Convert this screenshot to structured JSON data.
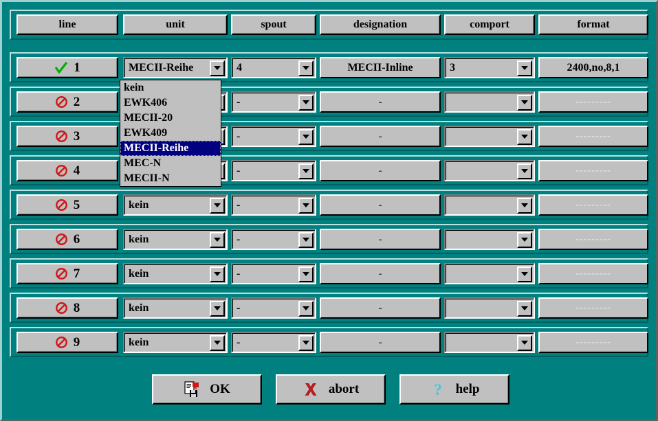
{
  "window": {
    "background_color": "#00807f",
    "control_color": "#c0c0c0"
  },
  "table": {
    "headers": [
      {
        "key": "line",
        "label": "line"
      },
      {
        "key": "unit",
        "label": "unit"
      },
      {
        "key": "spout",
        "label": "spout"
      },
      {
        "key": "designation",
        "label": "designation"
      },
      {
        "key": "comport",
        "label": "comport"
      },
      {
        "key": "format",
        "label": "format"
      }
    ],
    "rows": [
      {
        "line": "1",
        "status_icon": "check-icon",
        "enabled": true,
        "unit": "MECII-Reihe",
        "spout": "4",
        "designation": "MECII-Inline",
        "comport": "3",
        "format": "2400,no,8,1"
      },
      {
        "line": "2",
        "status_icon": "prohibited-icon",
        "enabled": false,
        "unit": "",
        "spout": "-",
        "designation": "-",
        "comport": "",
        "format": "---------"
      },
      {
        "line": "3",
        "status_icon": "prohibited-icon",
        "enabled": false,
        "unit": "",
        "spout": "-",
        "designation": "-",
        "comport": "",
        "format": "---------"
      },
      {
        "line": "4",
        "status_icon": "prohibited-icon",
        "enabled": false,
        "unit": "",
        "spout": "-",
        "designation": "-",
        "comport": "",
        "format": "---------"
      },
      {
        "line": "5",
        "status_icon": "prohibited-icon",
        "enabled": false,
        "unit": "kein",
        "spout": "-",
        "designation": "-",
        "comport": "",
        "format": "---------"
      },
      {
        "line": "6",
        "status_icon": "prohibited-icon",
        "enabled": false,
        "unit": "kein",
        "spout": "-",
        "designation": "-",
        "comport": "",
        "format": "---------"
      },
      {
        "line": "7",
        "status_icon": "prohibited-icon",
        "enabled": false,
        "unit": "kein",
        "spout": "-",
        "designation": "-",
        "comport": "",
        "format": "---------"
      },
      {
        "line": "8",
        "status_icon": "prohibited-icon",
        "enabled": false,
        "unit": "kein",
        "spout": "-",
        "designation": "-",
        "comport": "",
        "format": "---------"
      },
      {
        "line": "9",
        "status_icon": "prohibited-icon",
        "enabled": false,
        "unit": "kein",
        "spout": "-",
        "designation": "-",
        "comport": "",
        "format": "---------"
      }
    ]
  },
  "unit_dropdown": {
    "open": true,
    "owner_row": "1",
    "selected": "MECII-Reihe",
    "highlight_color": "#000080",
    "options": [
      "kein",
      "EWK406",
      "MECII-20",
      "EWK409",
      "MECII-Reihe",
      "MEC-N",
      "MECII-N"
    ]
  },
  "actions": {
    "ok": {
      "label": "OK",
      "icon": "save-document-icon"
    },
    "abort": {
      "label": "abort",
      "icon": "cross-icon",
      "icon_color": "#c00000"
    },
    "help": {
      "label": "help",
      "icon": "question-mark-icon",
      "icon_color": "#3cc8d8"
    }
  }
}
